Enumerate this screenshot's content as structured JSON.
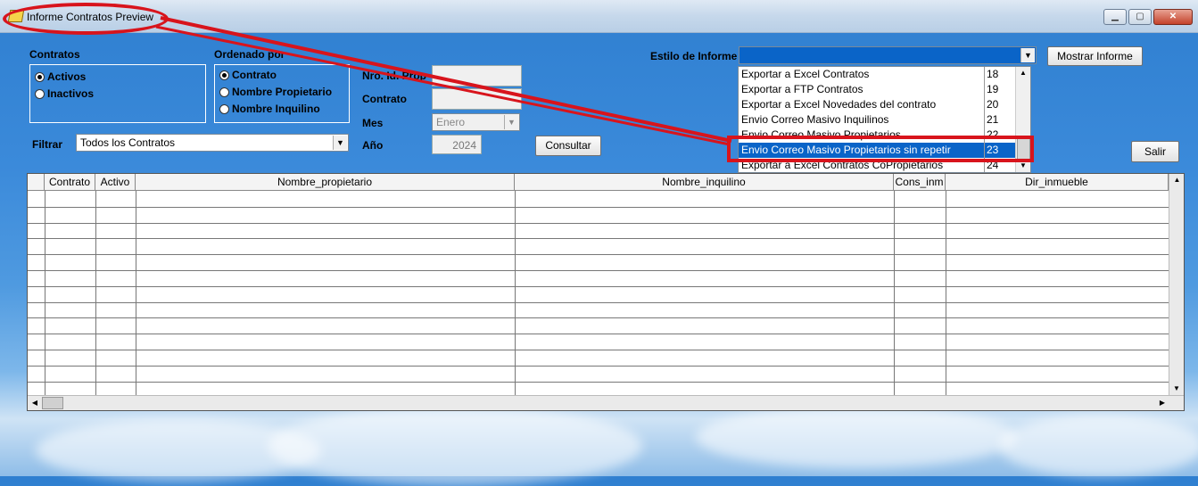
{
  "window": {
    "title": "Informe Contratos Preview"
  },
  "contratos": {
    "label": "Contratos",
    "options": [
      "Activos",
      "Inactivos"
    ],
    "selected": "Activos"
  },
  "ordenado": {
    "label": "Ordenado por",
    "options": [
      "Contrato",
      "Nombre Propietario",
      "Nombre Inquilino"
    ],
    "selected": "Contrato"
  },
  "fields": {
    "nro_label": "Nro. Id. Prop",
    "contrato_label": "Contrato",
    "mes_label": "Mes",
    "mes_value": "Enero",
    "anio_label": "Año",
    "anio_value": "2024"
  },
  "filtrar": {
    "label": "Filtrar",
    "value": "Todos los Contratos"
  },
  "consultar_label": "Consultar",
  "estilo": {
    "label": "Estilo de Informe",
    "value": ""
  },
  "mostrar_label": "Mostrar Informe",
  "salir_label": "Salir",
  "dropdown": {
    "items": [
      {
        "name": "Exportar a Excel Contratos",
        "code": "18"
      },
      {
        "name": "Exportar a FTP Contratos",
        "code": "19"
      },
      {
        "name": "Exportar a Excel Novedades del contrato",
        "code": "20"
      },
      {
        "name": "Envio Correo Masivo Inquilinos",
        "code": "21"
      },
      {
        "name": "Envio Correo Masivo Propietarios",
        "code": "22"
      },
      {
        "name": "Envio Correo Masivo Propietarios sin repetir",
        "code": "23"
      },
      {
        "name": "Exportar a Excel Contratos CoPropietarios",
        "code": "24"
      }
    ],
    "selected_index": 5
  },
  "grid": {
    "columns": [
      "Contrato",
      "Activo",
      "Nombre_propietario",
      "Nombre_inquilino",
      "Cons_inm",
      "Dir_inmueble"
    ]
  },
  "colors": {
    "annotation": "#d8141c",
    "selection": "#0a64c8"
  }
}
